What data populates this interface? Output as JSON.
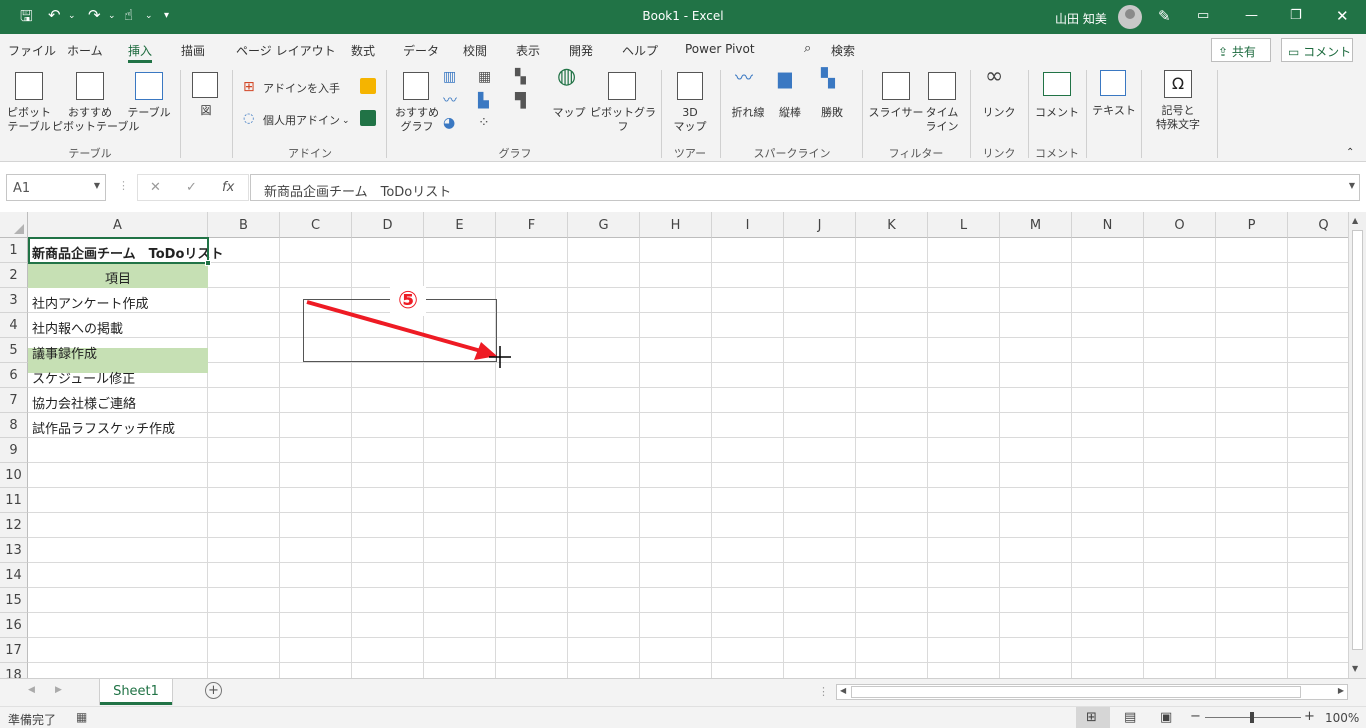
{
  "app": {
    "title": "Book1  -  Excel",
    "user": "山田 知美"
  },
  "menu_tabs": [
    "ファイル",
    "ホーム",
    "挿入",
    "描画",
    "ページ レイアウト",
    "数式",
    "データ",
    "校閲",
    "表示",
    "開発",
    "ヘルプ",
    "Power Pivot",
    "検索"
  ],
  "share_label": "共有",
  "comment_label": "コメント",
  "ribbon": {
    "pivot_table": "ピボット\nテーブル",
    "recommended_pivot": "おすすめ\nピボットテーブル",
    "table": "テーブル",
    "illustrations": "図",
    "get_addins": "アドインを入手",
    "my_addins": "個人用アドイン",
    "recommended_charts": "おすすめ\nグラフ",
    "maps": "マップ",
    "pivot_chart": "ピボットグラフ",
    "map_3d": "3D\nマップ",
    "line": "折れ線",
    "column": "縦棒",
    "win_loss": "勝敗",
    "slicer": "スライサー",
    "timeline": "タイム\nライン",
    "link": "リンク",
    "comment": "コメント",
    "text": "テキスト",
    "symbols": "記号と\n特殊文字",
    "groups": {
      "tables": "テーブル",
      "addins": "アドイン",
      "charts": "グラフ",
      "tours": "ツアー",
      "sparklines": "スパークライン",
      "filters": "フィルター",
      "links": "リンク",
      "comments": "コメント"
    }
  },
  "name_box": "A1",
  "formula_value": "新商品企画チーム　ToDoリスト",
  "columns": [
    "A",
    "B",
    "C",
    "D",
    "E",
    "F",
    "G",
    "H",
    "I",
    "J",
    "K",
    "L",
    "M",
    "N",
    "O",
    "P",
    "Q"
  ],
  "rows": [
    "1",
    "2",
    "3",
    "4",
    "5",
    "6",
    "7",
    "8",
    "9",
    "10",
    "11",
    "12",
    "13",
    "14",
    "15",
    "16",
    "17",
    "18"
  ],
  "cells": {
    "a1": "新商品企画チーム　ToDoリスト",
    "a2": "項目",
    "a3": "社内アンケート作成",
    "a4": "社内報への掲載",
    "a5": "議事録作成",
    "a6": "スケジュール修正",
    "a7": "協力会社様ご連絡",
    "a8": "試作品ラフスケッチ作成"
  },
  "annotation": {
    "step": "⑤"
  },
  "sheet_tab": "Sheet1",
  "status": {
    "ready": "準備完了",
    "zoom": "100%"
  },
  "colors": {
    "excel_green": "#217346",
    "header_fill": "#c6e0b4",
    "arrow_red": "#ee1b24"
  }
}
